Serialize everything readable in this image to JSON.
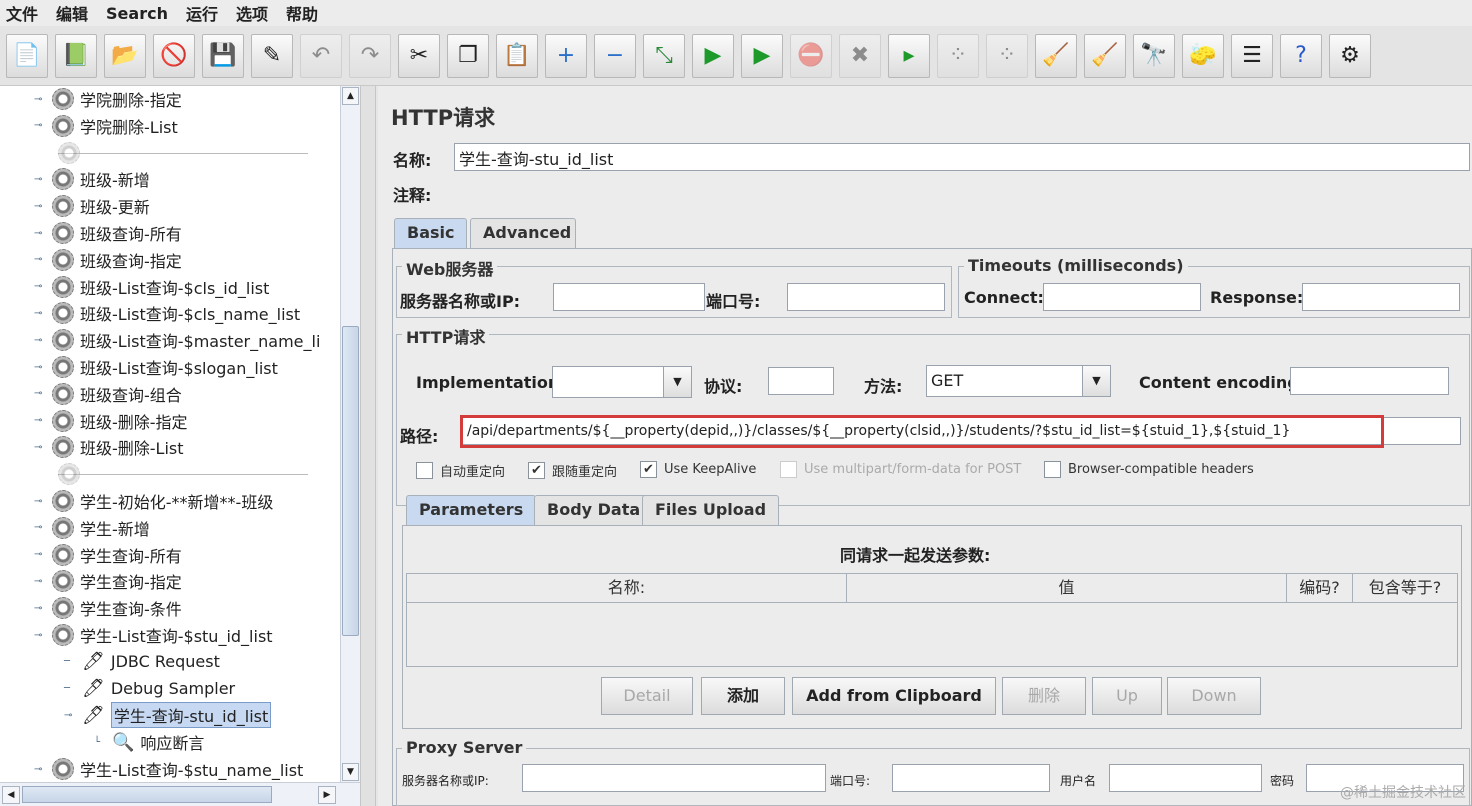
{
  "menubar": {
    "items": [
      "文件",
      "编辑",
      "Search",
      "运行",
      "选项",
      "帮助"
    ]
  },
  "toolbar": {
    "icons": [
      "new-icon",
      "templates-icon",
      "open-icon",
      "close-icon",
      "save-icon",
      "edit-icon",
      "undo-icon",
      "redo-icon",
      "cut-icon",
      "copy-icon",
      "paste-icon",
      "expand-icon",
      "collapse-icon",
      "toggle-icon",
      "start-icon",
      "start-no-pause-icon",
      "stop-icon",
      "shutdown-icon",
      "remote-start-icon",
      "remote-start-all-icon",
      "remote-stop-icon",
      "clear-icon",
      "clear-all-icon",
      "search-icon",
      "reset-search-icon",
      "function-helper-icon",
      "help-icon",
      "log-viewer-icon"
    ]
  },
  "tree": {
    "items": [
      {
        "label": "学院删除-指定",
        "type": "sampler"
      },
      {
        "label": "学院删除-List",
        "type": "sampler"
      },
      {
        "label": "",
        "type": "separator"
      },
      {
        "label": "班级-新增",
        "type": "sampler"
      },
      {
        "label": "班级-更新",
        "type": "sampler"
      },
      {
        "label": "班级查询-所有",
        "type": "sampler"
      },
      {
        "label": "班级查询-指定",
        "type": "sampler"
      },
      {
        "label": "班级-List查询-$cls_id_list",
        "type": "sampler"
      },
      {
        "label": "班级-List查询-$cls_name_list",
        "type": "sampler"
      },
      {
        "label": "班级-List查询-$master_name_li",
        "type": "sampler"
      },
      {
        "label": "班级-List查询-$slogan_list",
        "type": "sampler"
      },
      {
        "label": "班级查询-组合",
        "type": "sampler"
      },
      {
        "label": "班级-删除-指定",
        "type": "sampler"
      },
      {
        "label": "班级-删除-List",
        "type": "sampler"
      },
      {
        "label": "",
        "type": "separator"
      },
      {
        "label": "学生-初始化-**新增**-班级",
        "type": "sampler"
      },
      {
        "label": "学生-新增",
        "type": "sampler"
      },
      {
        "label": "学生查询-所有",
        "type": "sampler"
      },
      {
        "label": "学生查询-指定",
        "type": "sampler"
      },
      {
        "label": "学生查询-条件",
        "type": "sampler"
      },
      {
        "label": "学生-List查询-$stu_id_list",
        "type": "sampler-open"
      },
      {
        "label": "JDBC Request",
        "type": "child"
      },
      {
        "label": "Debug Sampler",
        "type": "child"
      },
      {
        "label": "学生-查询-stu_id_list",
        "type": "child-selected"
      },
      {
        "label": "响应断言",
        "type": "assertion"
      },
      {
        "label": "学生-List查询-$stu_name_list",
        "type": "sampler"
      }
    ]
  },
  "http": {
    "title": "HTTP请求",
    "name_label": "名称:",
    "name_value": "学生-查询-stu_id_list",
    "comment_label": "注释:",
    "comment_value": "",
    "tabs": [
      "Basic",
      "Advanced"
    ],
    "web_server": {
      "title": "Web服务器",
      "server_label": "服务器名称或IP:",
      "port_label": "端口号:"
    },
    "timeouts": {
      "title": "Timeouts (milliseconds)",
      "connect_label": "Connect:",
      "response_label": "Response:"
    },
    "request": {
      "title": "HTTP请求",
      "impl_label": "Implementation:",
      "impl_value": "",
      "protocol_label": "协议:",
      "method_label": "方法:",
      "method_value": "GET",
      "encoding_label": "Content encoding:",
      "path_label": "路径:",
      "path_value": "/api/departments/${__property(depid,,)}/classes/${__property(clsid,,)}/students/?$stu_id_list=${stuid_1},${stuid_1}"
    },
    "options": [
      {
        "label": "自动重定向",
        "checked": false,
        "enabled": true
      },
      {
        "label": "跟随重定向",
        "checked": true,
        "enabled": true
      },
      {
        "label": "Use KeepAlive",
        "checked": true,
        "enabled": true
      },
      {
        "label": "Use multipart/form-data for POST",
        "checked": false,
        "enabled": false
      },
      {
        "label": "Browser-compatible headers",
        "checked": false,
        "enabled": true
      }
    ],
    "param_tabs": [
      "Parameters",
      "Body Data",
      "Files Upload"
    ],
    "params": {
      "caption": "同请求一起发送参数:",
      "columns": [
        "名称:",
        "值",
        "编码?",
        "包含等于?"
      ]
    },
    "buttons": {
      "detail": "Detail",
      "add": "添加",
      "add_clipboard": "Add from Clipboard",
      "delete": "删除",
      "up": "Up",
      "down": "Down"
    },
    "proxy": {
      "title": "Proxy Server",
      "server_label": "服务器名称或IP:",
      "port_label": "端口号:",
      "user_label": "用户名",
      "password_label": "密码"
    }
  },
  "watermark": "@稀土掘金技术社区"
}
